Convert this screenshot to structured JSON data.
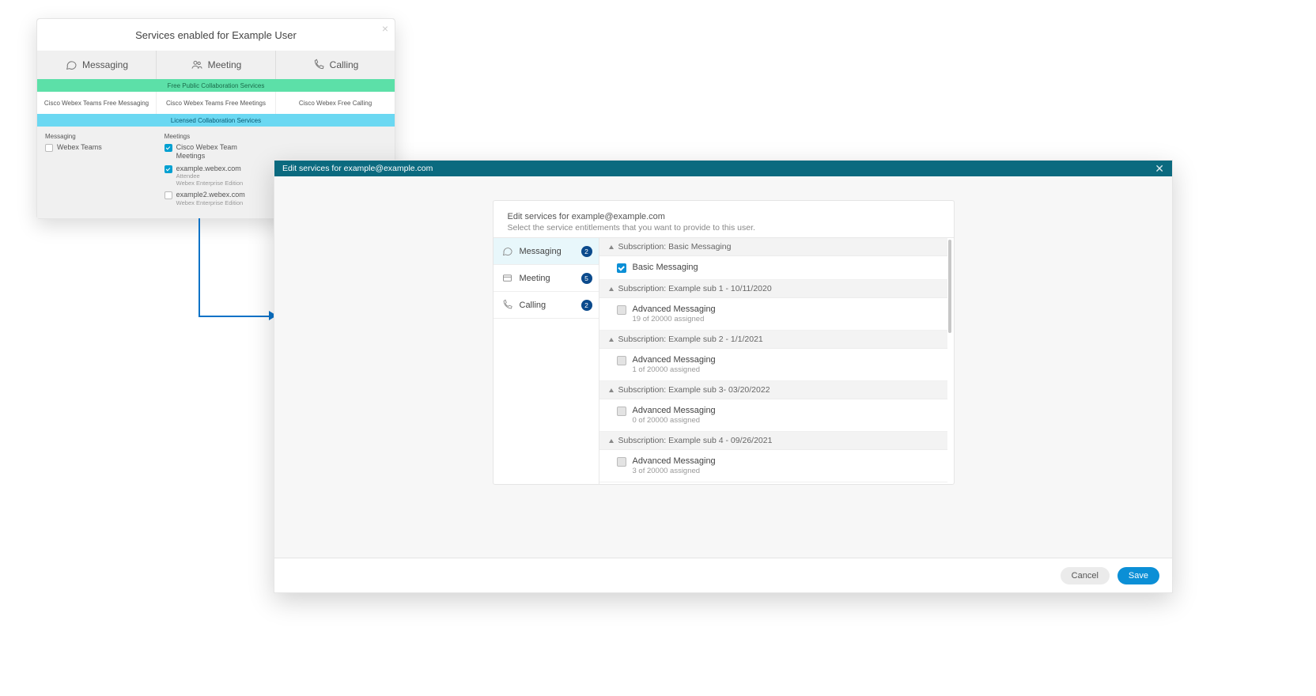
{
  "old_dialog": {
    "title": "Services enabled for Example User",
    "tabs": {
      "messaging": "Messaging",
      "meeting": "Meeting",
      "calling": "Calling"
    },
    "bands": {
      "free": "Free Public Collaboration Services",
      "licensed": "Licensed Collaboration Services"
    },
    "free_row": {
      "c1": "Cisco Webex Teams Free Messaging",
      "c2": "Cisco Webex Teams Free Meetings",
      "c3": "Cisco Webex Free Calling"
    },
    "lic": {
      "messaging": {
        "heading": "Messaging",
        "items": [
          {
            "label": "Webex Teams",
            "checked": false
          }
        ]
      },
      "meetings": {
        "heading": "Meetings",
        "items": [
          {
            "label": "Cisco Webex Team Meetings",
            "checked": true
          },
          {
            "label": "example.webex.com",
            "checked": true,
            "sub1": "Attendee",
            "sub2": "Webex Enterprise Edition"
          },
          {
            "label": "example2.webex.com",
            "checked": false,
            "sub2": "Webex Enterprise Edition"
          }
        ]
      }
    }
  },
  "new_dialog": {
    "header": "Edit services for example@example.com",
    "panel_title": "Edit services for example@example.com",
    "panel_sub": "Select the service entitlements that you want to provide to this user.",
    "side": [
      {
        "key": "messaging",
        "label": "Messaging",
        "badge": "2",
        "active": true
      },
      {
        "key": "meeting",
        "label": "Meeting",
        "badge": "5"
      },
      {
        "key": "calling",
        "label": "Calling",
        "badge": "2"
      }
    ],
    "groups": [
      {
        "title": "Subscription: Basic Messaging",
        "options": [
          {
            "label": "Basic Messaging",
            "checked": true
          }
        ]
      },
      {
        "title": "Subscription: Example sub 1 - 10/11/2020",
        "options": [
          {
            "label": "Advanced Messaging",
            "sub": "19 of 20000 assigned",
            "checked": false
          }
        ]
      },
      {
        "title": "Subscription: Example sub 2 - 1/1/2021",
        "options": [
          {
            "label": "Advanced Messaging",
            "sub": "1 of 20000 assigned",
            "checked": false
          }
        ]
      },
      {
        "title": "Subscription: Example sub 3- 03/20/2022",
        "options": [
          {
            "label": "Advanced Messaging",
            "sub": "0 of 20000 assigned",
            "checked": false
          }
        ]
      },
      {
        "title": "Subscription: Example sub 4 - 09/26/2021",
        "options": [
          {
            "label": "Advanced Messaging",
            "sub": "3 of 20000 assigned",
            "checked": false
          }
        ]
      }
    ],
    "buttons": {
      "cancel": "Cancel",
      "save": "Save"
    }
  }
}
